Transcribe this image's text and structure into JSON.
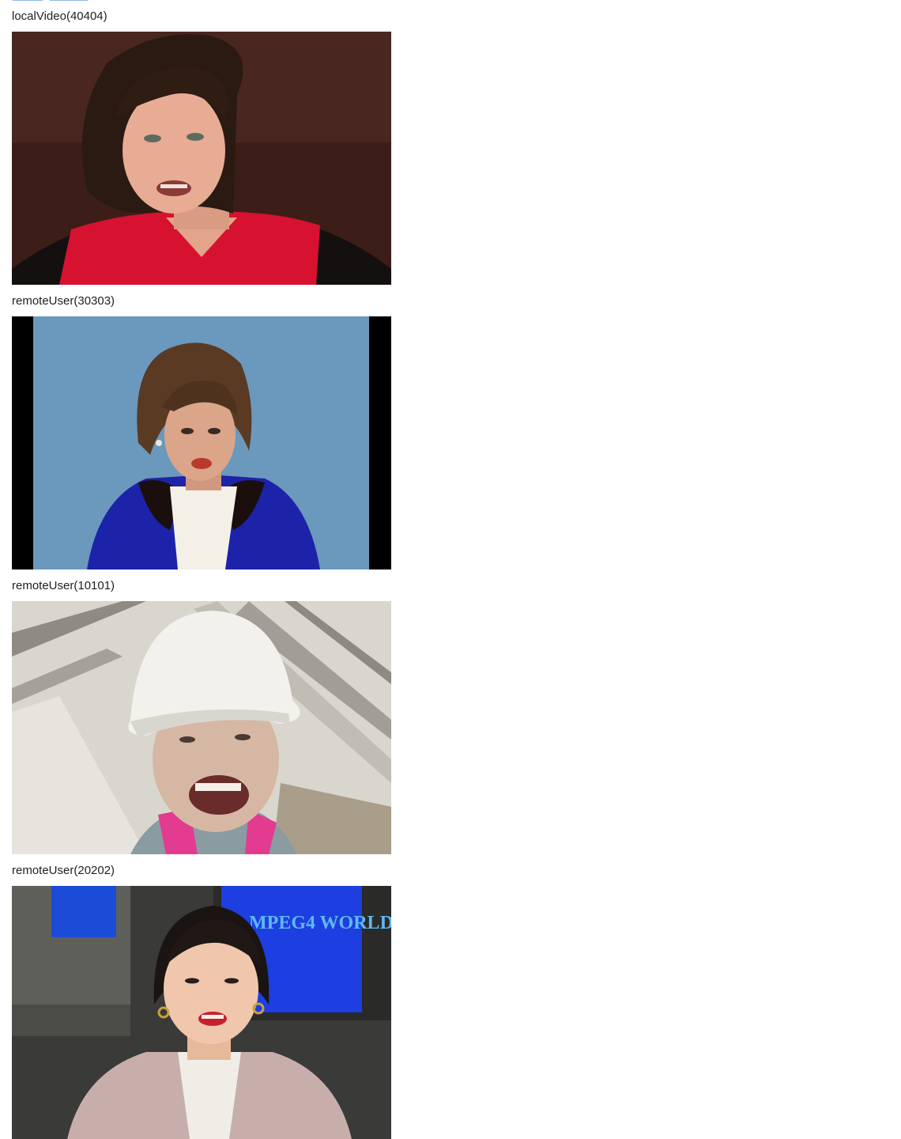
{
  "toolbar": {
    "buttons": [
      {
        "label": ""
      },
      {
        "label": ""
      }
    ]
  },
  "streams": [
    {
      "label": "localVideo(40404)"
    },
    {
      "label": "remoteUser(30303)"
    },
    {
      "label": "remoteUser(10101)"
    },
    {
      "label": "remoteUser(20202)",
      "screen_text": "MPEG4 WORLD"
    }
  ]
}
